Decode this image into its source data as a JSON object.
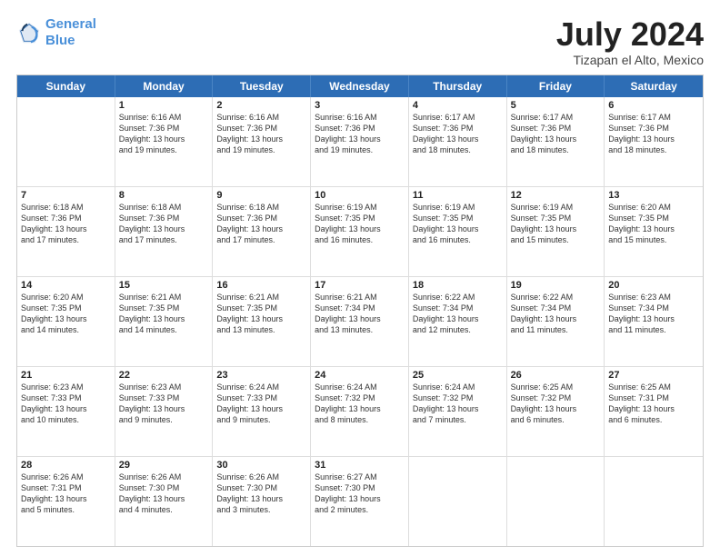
{
  "logo": {
    "line1": "General",
    "line2": "Blue"
  },
  "title": "July 2024",
  "location": "Tizapan el Alto, Mexico",
  "weekdays": [
    "Sunday",
    "Monday",
    "Tuesday",
    "Wednesday",
    "Thursday",
    "Friday",
    "Saturday"
  ],
  "weeks": [
    [
      {
        "day": "",
        "lines": []
      },
      {
        "day": "1",
        "lines": [
          "Sunrise: 6:16 AM",
          "Sunset: 7:36 PM",
          "Daylight: 13 hours",
          "and 19 minutes."
        ]
      },
      {
        "day": "2",
        "lines": [
          "Sunrise: 6:16 AM",
          "Sunset: 7:36 PM",
          "Daylight: 13 hours",
          "and 19 minutes."
        ]
      },
      {
        "day": "3",
        "lines": [
          "Sunrise: 6:16 AM",
          "Sunset: 7:36 PM",
          "Daylight: 13 hours",
          "and 19 minutes."
        ]
      },
      {
        "day": "4",
        "lines": [
          "Sunrise: 6:17 AM",
          "Sunset: 7:36 PM",
          "Daylight: 13 hours",
          "and 18 minutes."
        ]
      },
      {
        "day": "5",
        "lines": [
          "Sunrise: 6:17 AM",
          "Sunset: 7:36 PM",
          "Daylight: 13 hours",
          "and 18 minutes."
        ]
      },
      {
        "day": "6",
        "lines": [
          "Sunrise: 6:17 AM",
          "Sunset: 7:36 PM",
          "Daylight: 13 hours",
          "and 18 minutes."
        ]
      }
    ],
    [
      {
        "day": "7",
        "lines": [
          "Sunrise: 6:18 AM",
          "Sunset: 7:36 PM",
          "Daylight: 13 hours",
          "and 17 minutes."
        ]
      },
      {
        "day": "8",
        "lines": [
          "Sunrise: 6:18 AM",
          "Sunset: 7:36 PM",
          "Daylight: 13 hours",
          "and 17 minutes."
        ]
      },
      {
        "day": "9",
        "lines": [
          "Sunrise: 6:18 AM",
          "Sunset: 7:36 PM",
          "Daylight: 13 hours",
          "and 17 minutes."
        ]
      },
      {
        "day": "10",
        "lines": [
          "Sunrise: 6:19 AM",
          "Sunset: 7:35 PM",
          "Daylight: 13 hours",
          "and 16 minutes."
        ]
      },
      {
        "day": "11",
        "lines": [
          "Sunrise: 6:19 AM",
          "Sunset: 7:35 PM",
          "Daylight: 13 hours",
          "and 16 minutes."
        ]
      },
      {
        "day": "12",
        "lines": [
          "Sunrise: 6:19 AM",
          "Sunset: 7:35 PM",
          "Daylight: 13 hours",
          "and 15 minutes."
        ]
      },
      {
        "day": "13",
        "lines": [
          "Sunrise: 6:20 AM",
          "Sunset: 7:35 PM",
          "Daylight: 13 hours",
          "and 15 minutes."
        ]
      }
    ],
    [
      {
        "day": "14",
        "lines": [
          "Sunrise: 6:20 AM",
          "Sunset: 7:35 PM",
          "Daylight: 13 hours",
          "and 14 minutes."
        ]
      },
      {
        "day": "15",
        "lines": [
          "Sunrise: 6:21 AM",
          "Sunset: 7:35 PM",
          "Daylight: 13 hours",
          "and 14 minutes."
        ]
      },
      {
        "day": "16",
        "lines": [
          "Sunrise: 6:21 AM",
          "Sunset: 7:35 PM",
          "Daylight: 13 hours",
          "and 13 minutes."
        ]
      },
      {
        "day": "17",
        "lines": [
          "Sunrise: 6:21 AM",
          "Sunset: 7:34 PM",
          "Daylight: 13 hours",
          "and 13 minutes."
        ]
      },
      {
        "day": "18",
        "lines": [
          "Sunrise: 6:22 AM",
          "Sunset: 7:34 PM",
          "Daylight: 13 hours",
          "and 12 minutes."
        ]
      },
      {
        "day": "19",
        "lines": [
          "Sunrise: 6:22 AM",
          "Sunset: 7:34 PM",
          "Daylight: 13 hours",
          "and 11 minutes."
        ]
      },
      {
        "day": "20",
        "lines": [
          "Sunrise: 6:23 AM",
          "Sunset: 7:34 PM",
          "Daylight: 13 hours",
          "and 11 minutes."
        ]
      }
    ],
    [
      {
        "day": "21",
        "lines": [
          "Sunrise: 6:23 AM",
          "Sunset: 7:33 PM",
          "Daylight: 13 hours",
          "and 10 minutes."
        ]
      },
      {
        "day": "22",
        "lines": [
          "Sunrise: 6:23 AM",
          "Sunset: 7:33 PM",
          "Daylight: 13 hours",
          "and 9 minutes."
        ]
      },
      {
        "day": "23",
        "lines": [
          "Sunrise: 6:24 AM",
          "Sunset: 7:33 PM",
          "Daylight: 13 hours",
          "and 9 minutes."
        ]
      },
      {
        "day": "24",
        "lines": [
          "Sunrise: 6:24 AM",
          "Sunset: 7:32 PM",
          "Daylight: 13 hours",
          "and 8 minutes."
        ]
      },
      {
        "day": "25",
        "lines": [
          "Sunrise: 6:24 AM",
          "Sunset: 7:32 PM",
          "Daylight: 13 hours",
          "and 7 minutes."
        ]
      },
      {
        "day": "26",
        "lines": [
          "Sunrise: 6:25 AM",
          "Sunset: 7:32 PM",
          "Daylight: 13 hours",
          "and 6 minutes."
        ]
      },
      {
        "day": "27",
        "lines": [
          "Sunrise: 6:25 AM",
          "Sunset: 7:31 PM",
          "Daylight: 13 hours",
          "and 6 minutes."
        ]
      }
    ],
    [
      {
        "day": "28",
        "lines": [
          "Sunrise: 6:26 AM",
          "Sunset: 7:31 PM",
          "Daylight: 13 hours",
          "and 5 minutes."
        ]
      },
      {
        "day": "29",
        "lines": [
          "Sunrise: 6:26 AM",
          "Sunset: 7:30 PM",
          "Daylight: 13 hours",
          "and 4 minutes."
        ]
      },
      {
        "day": "30",
        "lines": [
          "Sunrise: 6:26 AM",
          "Sunset: 7:30 PM",
          "Daylight: 13 hours",
          "and 3 minutes."
        ]
      },
      {
        "day": "31",
        "lines": [
          "Sunrise: 6:27 AM",
          "Sunset: 7:30 PM",
          "Daylight: 13 hours",
          "and 2 minutes."
        ]
      },
      {
        "day": "",
        "lines": []
      },
      {
        "day": "",
        "lines": []
      },
      {
        "day": "",
        "lines": []
      }
    ]
  ]
}
